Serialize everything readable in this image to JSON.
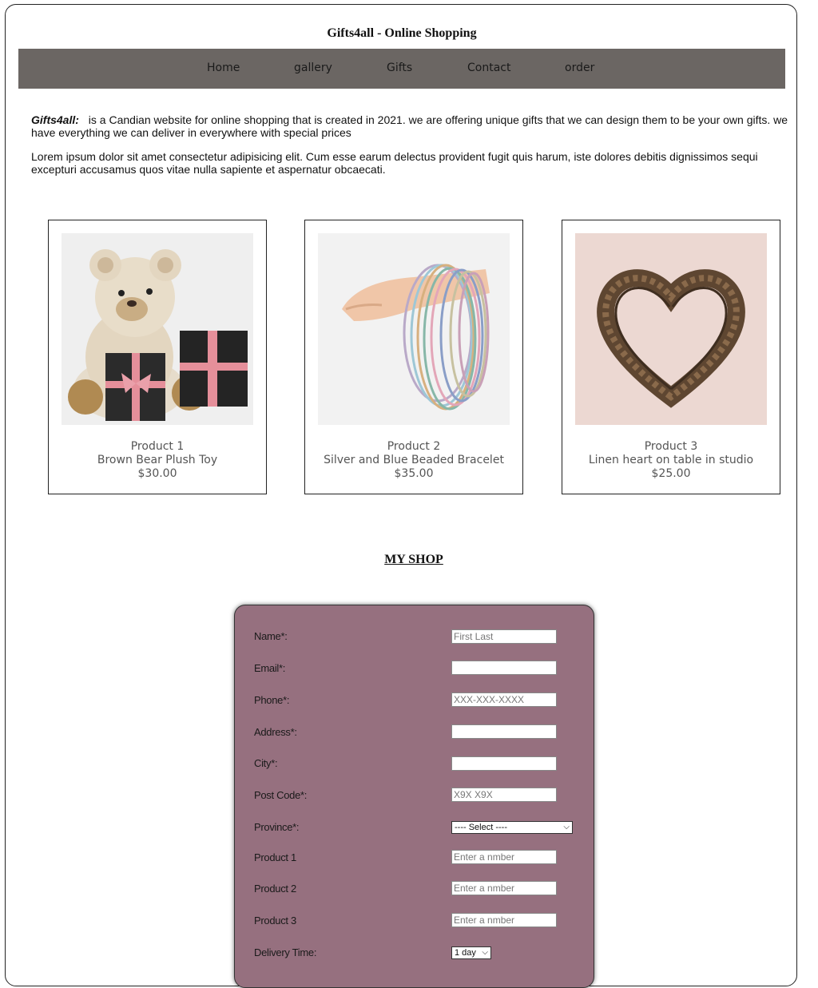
{
  "header": {
    "title": "Gifts4all - Online Shopping"
  },
  "nav": {
    "items": [
      {
        "label": "Home"
      },
      {
        "label": "gallery"
      },
      {
        "label": "Gifts"
      },
      {
        "label": "Contact"
      },
      {
        "label": "order"
      }
    ]
  },
  "intro": {
    "brand": "Gifts4all:",
    "line1": "is a Candian website for online shopping that is created in 2021. we are offering unique gifts that we can design them to be your own gifts. we have everything we can deliver in everywhere with special prices",
    "line2": "Lorem ipsum dolor sit amet consectetur adipisicing elit. Cum esse earum delectus provident fugit quis harum, iste dolores debitis dignissimos sequi excepturi accusamus quos vitae nulla sapiente et aspernatur obcaecati."
  },
  "products": [
    {
      "name": "Product 1",
      "desc": "Brown Bear Plush Toy",
      "price": "$30.00",
      "image": "teddy-bear-with-gift-boxes"
    },
    {
      "name": "Product 2",
      "desc": "Silver and Blue Beaded Bracelet",
      "price": "$35.00",
      "image": "hand-with-beaded-bracelets"
    },
    {
      "name": "Product 3",
      "desc": "Linen heart on table in studio",
      "price": "$25.00",
      "image": "twig-heart-wreath"
    }
  ],
  "shop": {
    "title": "MY SHOP",
    "fields": {
      "name": {
        "label": "Name*:",
        "placeholder": "First Last"
      },
      "email": {
        "label": "Email*:",
        "placeholder": ""
      },
      "phone": {
        "label": "Phone*:",
        "placeholder": "XXX-XXX-XXXX"
      },
      "address": {
        "label": "Address*:",
        "placeholder": ""
      },
      "city": {
        "label": "City*:",
        "placeholder": ""
      },
      "postcode": {
        "label": "Post Code*:",
        "placeholder": "X9X X9X"
      },
      "province": {
        "label": "Province*:",
        "selected": "---- Select ----"
      },
      "product1": {
        "label": "Product 1",
        "placeholder": "Enter a nmber"
      },
      "product2": {
        "label": "Product 2",
        "placeholder": "Enter a nmber"
      },
      "product3": {
        "label": "Product 3",
        "placeholder": "Enter a nmber"
      },
      "delivery": {
        "label": "Delivery Time:",
        "selected": "1 day"
      }
    }
  },
  "colors": {
    "nav_bg": "#6b6663",
    "form_bg": "#96707f"
  }
}
